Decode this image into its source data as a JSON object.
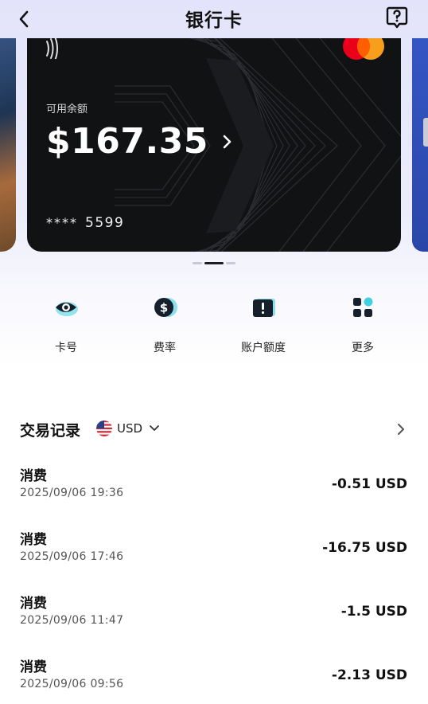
{
  "header": {
    "title": "银行卡",
    "back_icon": "chevron-left-icon",
    "help_icon": "help-bubble-icon"
  },
  "card": {
    "balance_label": "可用余额",
    "balance": "$167.35",
    "mask": "****",
    "last4": "5599",
    "brand": "mastercard-logo",
    "colors": {
      "card_bg": "#111214",
      "mc_red": "#eb001b",
      "mc_orange": "#f79e1b"
    }
  },
  "carousel": {
    "count": 3,
    "active_index": 1
  },
  "actions": [
    {
      "label": "卡号",
      "icon": "eye-icon"
    },
    {
      "label": "费率",
      "icon": "dollar-coin-icon"
    },
    {
      "label": "账户额度",
      "icon": "alert-card-icon"
    },
    {
      "label": "更多",
      "icon": "grid-icon"
    }
  ],
  "transactions": {
    "title": "交易记录",
    "currency": "USD",
    "currency_flag": "us-flag-icon",
    "items": [
      {
        "type": "消费",
        "time": "2025/09/06 19:36",
        "amount": "-0.51 USD"
      },
      {
        "type": "消费",
        "time": "2025/09/06 17:46",
        "amount": "-16.75 USD"
      },
      {
        "type": "消费",
        "time": "2025/09/06 11:47",
        "amount": "-1.5 USD"
      },
      {
        "type": "消费",
        "time": "2025/09/06 09:56",
        "amount": "-2.13 USD"
      }
    ]
  },
  "accent": {
    "teal": "#3fd1e0",
    "dark": "#15202c"
  }
}
